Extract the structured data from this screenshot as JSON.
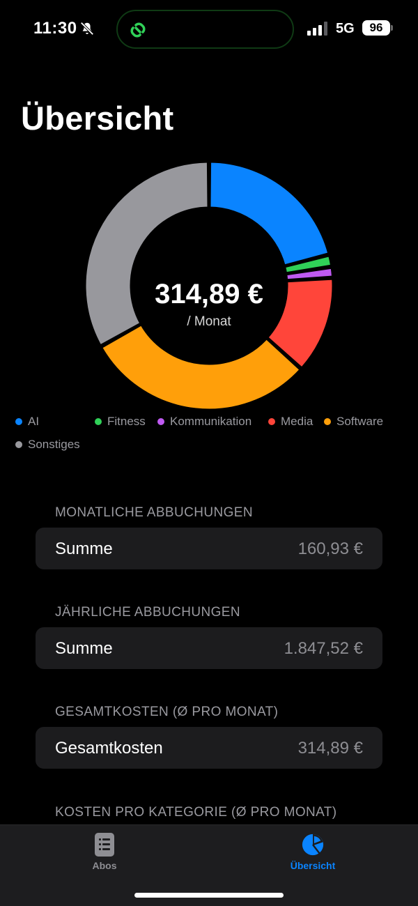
{
  "status_bar": {
    "time": "11:30",
    "network": "5G",
    "battery": "96"
  },
  "page": {
    "title": "Übersicht"
  },
  "summary": {
    "total": "314,89 €",
    "unit": "/ Monat"
  },
  "chart_data": {
    "type": "pie",
    "donut": true,
    "title": "",
    "categories": [
      "AI",
      "Fitness",
      "Kommunikation",
      "Media",
      "Software",
      "Sonstiges"
    ],
    "values": [
      66.0,
      5.0,
      4.5,
      40.0,
      95.0,
      104.39
    ],
    "colors": [
      "#0a84ff",
      "#30d158",
      "#bf5af2",
      "#ff453a",
      "#ff9f0a",
      "#98989d"
    ],
    "center_label": "314,89 €",
    "center_sublabel": "/ Monat"
  },
  "legend": [
    {
      "label": "AI",
      "color": "#0a84ff"
    },
    {
      "label": "Fitness",
      "color": "#30d158"
    },
    {
      "label": "Kommunikation",
      "color": "#bf5af2"
    },
    {
      "label": "Media",
      "color": "#ff453a"
    },
    {
      "label": "Software",
      "color": "#ff9f0a"
    },
    {
      "label": "Sonstiges",
      "color": "#98989d"
    }
  ],
  "sections": {
    "monthly": {
      "header": "MONATLICHE ABBUCHUNGEN",
      "label": "Summe",
      "value": "160,93 €"
    },
    "yearly": {
      "header": "JÄHRLICHE ABBUCHUNGEN",
      "label": "Summe",
      "value": "1.847,52 €"
    },
    "total": {
      "header": "GESAMTKOSTEN (Ø PRO MONAT)",
      "label": "Gesamtkosten",
      "value": "314,89 €"
    },
    "category": {
      "header": "KOSTEN PRO KATEGORIE (Ø PRO MONAT)"
    }
  },
  "tab_bar": {
    "tabs": [
      {
        "label": "Abos",
        "icon": "list-document-icon",
        "active": false
      },
      {
        "label": "Übersicht",
        "icon": "pie-chart-icon",
        "active": true
      }
    ],
    "active_color": "#0a84ff",
    "inactive_color": "#8e8e93"
  }
}
